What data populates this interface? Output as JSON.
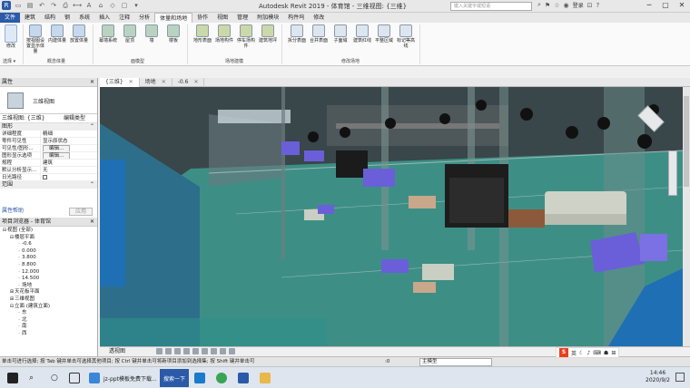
{
  "window": {
    "title": "Autodesk Revit 2019 - 体育馆 - 三维视图: {三维}",
    "search_placeholder": "键入关键字或短语",
    "login": "登录"
  },
  "ribbon_tabs": [
    "文件",
    "建筑",
    "结构",
    "钢",
    "系统",
    "插入",
    "注释",
    "分析",
    "体量和场地",
    "协作",
    "视图",
    "管理",
    "附加模块",
    "构件坞",
    "修改"
  ],
  "active_tab_index": 8,
  "ribbon": {
    "modify": "修改",
    "select": "选择 ▾",
    "groups": [
      {
        "label": "概念体量",
        "buttons": [
          "按视图设置显示体量",
          "内建体量",
          "放置体量"
        ]
      },
      {
        "label": "面模型",
        "buttons": [
          "幕墙系统",
          "屋顶",
          "墙",
          "楼板"
        ]
      },
      {
        "label": "场地建模",
        "buttons": [
          "地形表面",
          "场地构件",
          "停车场构件",
          "建筑地坪"
        ]
      },
      {
        "label": "修改场地",
        "buttons": [
          "拆分表面",
          "合并表面",
          "子面域",
          "建筑红线",
          "平整区域",
          "标记等高线"
        ]
      }
    ]
  },
  "properties": {
    "header": "属性",
    "type_name": "三维视图",
    "selector": "三维视图: {三维}",
    "edit_type": "编辑类型",
    "section": "图形",
    "rows": [
      {
        "k": "详细程度",
        "v": "精细"
      },
      {
        "k": "零件可见性",
        "v": "显示原状态"
      },
      {
        "k": "可见性/图形...",
        "v": "编辑..."
      },
      {
        "k": "图形显示选项",
        "v": "编辑..."
      },
      {
        "k": "规程",
        "v": "建筑"
      },
      {
        "k": "默认分析显示...",
        "v": "无"
      },
      {
        "k": "日光路径",
        "v": ""
      }
    ],
    "section2": "范围",
    "help": "属性帮助",
    "apply": "应用"
  },
  "browser": {
    "header": "项目浏览器 - 体育馆",
    "nodes": [
      {
        "label": "视图 (全部)",
        "level": 0,
        "tw": "⊟"
      },
      {
        "label": "楼层平面",
        "level": 1,
        "tw": "⊟"
      },
      {
        "label": "-0.6",
        "level": 2,
        "tw": ""
      },
      {
        "label": "0.000",
        "level": 2,
        "tw": ""
      },
      {
        "label": "3.800",
        "level": 2,
        "tw": ""
      },
      {
        "label": "8.800",
        "level": 2,
        "tw": ""
      },
      {
        "label": "12.000",
        "level": 2,
        "tw": ""
      },
      {
        "label": "14.500",
        "level": 2,
        "tw": ""
      },
      {
        "label": "场地",
        "level": 2,
        "tw": ""
      },
      {
        "label": "天花板平面",
        "level": 1,
        "tw": "⊞"
      },
      {
        "label": "三维视图",
        "level": 1,
        "tw": "⊞"
      },
      {
        "label": "立面 (建筑立面)",
        "level": 1,
        "tw": "⊟"
      },
      {
        "label": "东",
        "level": 2,
        "tw": ""
      },
      {
        "label": "北",
        "level": 2,
        "tw": ""
      },
      {
        "label": "南",
        "level": 2,
        "tw": ""
      },
      {
        "label": "西",
        "level": 2,
        "tw": ""
      }
    ]
  },
  "view_tabs": [
    {
      "label": "{三维}",
      "active": true
    },
    {
      "label": "场地",
      "active": false
    },
    {
      "label": "-0.6",
      "active": false
    }
  ],
  "view_control": {
    "scale": "透视图"
  },
  "status": {
    "message": "单击可进行选择; 按 Tab 键并单击可选择其他项目; 按 Ctrl 键并单击可将新项目添加到选择集; 按 Shift 键并单击可",
    "count": ":0",
    "model": "主模型"
  },
  "ime": {
    "logo": "S",
    "lang": "英"
  },
  "taskbar": {
    "items": [
      "jz-ppt模板免费下载...",
      "搜索一下"
    ],
    "time": "14:46",
    "date": "2020/9/2"
  },
  "colors": {
    "file_tab": "#2a5aa8",
    "viewport_bg": "#3c4a4c",
    "floor": "#3d8f86",
    "sofa_blue": "#6a5fd8"
  }
}
